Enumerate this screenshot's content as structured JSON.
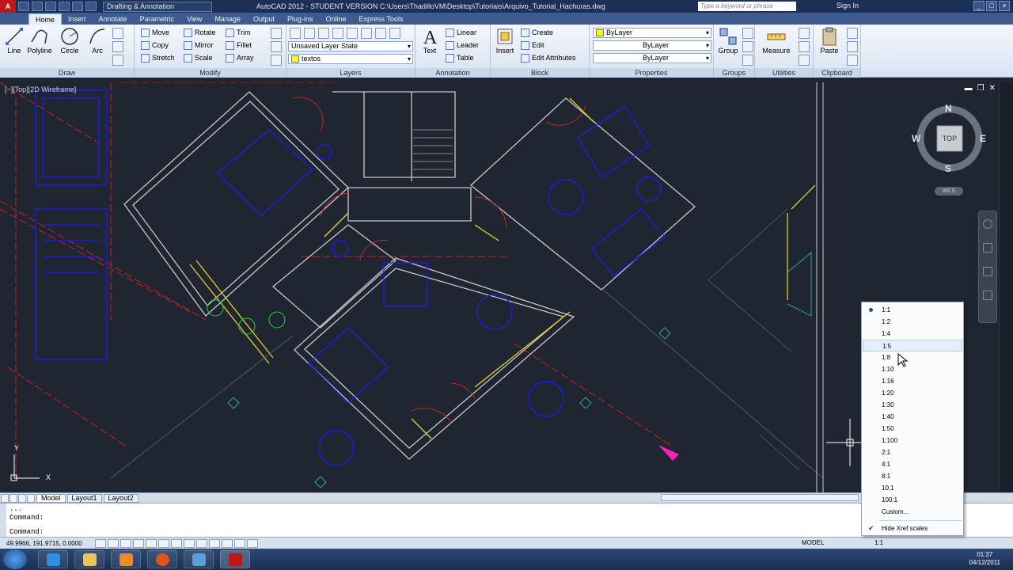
{
  "titlebar": {
    "workspace": "Drafting & Annotation",
    "app_title": "AutoCAD 2012 - STUDENT VERSION    C:\\Users\\ThadilloVM\\Desktop\\Tutoriais\\Arquivo_Tutorial_Hachuras.dwg",
    "search_placeholder": "Type a keyword or phrase",
    "sign_in": "Sign In"
  },
  "tabs": [
    "Home",
    "Insert",
    "Annotate",
    "Parametric",
    "View",
    "Manage",
    "Output",
    "Plug-ins",
    "Online",
    "Express Tools"
  ],
  "ribbon": {
    "draw": {
      "title": "Draw",
      "line": "Line",
      "polyline": "Polyline",
      "circle": "Circle",
      "arc": "Arc"
    },
    "modify": {
      "title": "Modify",
      "move": "Move",
      "rotate": "Rotate",
      "trim": "Trim",
      "copy": "Copy",
      "mirror": "Mirror",
      "fillet": "Fillet",
      "stretch": "Stretch",
      "scale": "Scale",
      "array": "Array"
    },
    "layers": {
      "title": "Layers",
      "layer_state": "Unsaved Layer State",
      "current_layer": "textos"
    },
    "annotation": {
      "title": "Annotation",
      "text": "Text",
      "linear": "Linear",
      "leader": "Leader",
      "table": "Table"
    },
    "block": {
      "title": "Block",
      "insert": "Insert",
      "create": "Create",
      "edit": "Edit",
      "edit_attributes": "Edit Attributes"
    },
    "properties": {
      "title": "Properties",
      "color": "ByLayer",
      "linetype": "ByLayer",
      "lineweight": "ByLayer"
    },
    "groups": {
      "title": "Groups",
      "group": "Group"
    },
    "utilities": {
      "title": "Utilities",
      "measure": "Measure"
    },
    "clipboard": {
      "title": "Clipboard",
      "paste": "Paste"
    }
  },
  "viewport": {
    "label": "[−][Top][2D Wireframe]"
  },
  "viewcube": {
    "north": "N",
    "south": "S",
    "east": "E",
    "west": "W",
    "face": "TOP",
    "wcs": "WCS"
  },
  "ucs": {
    "y": "Y",
    "x": "X"
  },
  "layout_tabs": [
    "Model",
    "Layout1",
    "Layout2"
  ],
  "command": {
    "history": "...",
    "line1": "Command:",
    "line2": "Command:"
  },
  "status": {
    "coords": "49.9966, 191.9715, 0.0000",
    "model": "MODEL",
    "scale": "1:1"
  },
  "scale_menu": {
    "items": [
      "1:1",
      "1:2",
      "1:4",
      "1:5",
      "1:8",
      "1:10",
      "1:16",
      "1:20",
      "1:30",
      "1:40",
      "1:50",
      "1:100",
      "2:1",
      "4:1",
      "8:1",
      "10:1",
      "100:1",
      "Custom..."
    ],
    "selected": "1:1",
    "hovered": "1:5",
    "hide_xref": "Hide Xref scales"
  },
  "clock": {
    "time": "01:37",
    "date": "04/12/2011"
  },
  "colors": {
    "bg": "#1f2632",
    "wall": "#c8c8c8",
    "blue": "#1a1aff",
    "red": "#cc2020",
    "yellow": "#e8d020",
    "cyan": "#2aa89a"
  }
}
